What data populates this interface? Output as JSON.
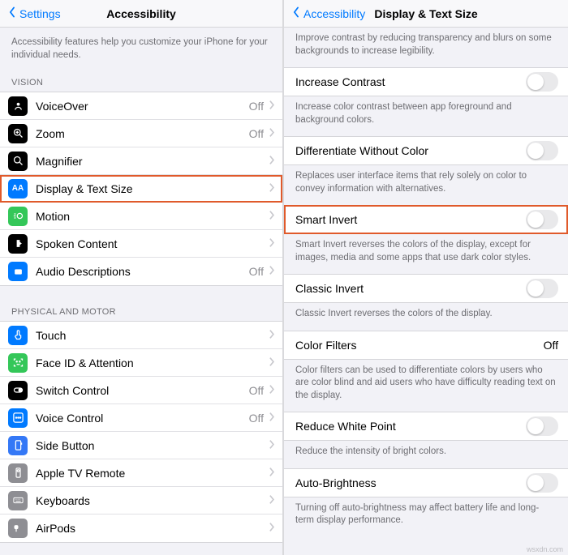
{
  "left": {
    "back": "Settings",
    "title": "Accessibility",
    "intro": "Accessibility features help you customize your iPhone for your individual needs.",
    "vision_header": "VISION",
    "vision": [
      {
        "label": "VoiceOver",
        "value": "Off",
        "icon": "voiceover",
        "bg": "bg-black"
      },
      {
        "label": "Zoom",
        "value": "Off",
        "icon": "zoom",
        "bg": "bg-black"
      },
      {
        "label": "Magnifier",
        "value": "",
        "icon": "magnifier",
        "bg": "bg-black"
      },
      {
        "label": "Display & Text Size",
        "value": "",
        "icon": "display-text",
        "bg": "bg-blue",
        "hl": true
      },
      {
        "label": "Motion",
        "value": "",
        "icon": "motion",
        "bg": "bg-green"
      },
      {
        "label": "Spoken Content",
        "value": "",
        "icon": "spoken",
        "bg": "bg-black"
      },
      {
        "label": "Audio Descriptions",
        "value": "Off",
        "icon": "audio-desc",
        "bg": "bg-blue"
      }
    ],
    "motor_header": "PHYSICAL AND MOTOR",
    "motor": [
      {
        "label": "Touch",
        "value": "",
        "icon": "touch",
        "bg": "bg-blue"
      },
      {
        "label": "Face ID & Attention",
        "value": "",
        "icon": "faceid",
        "bg": "bg-green"
      },
      {
        "label": "Switch Control",
        "value": "Off",
        "icon": "switch",
        "bg": "bg-black"
      },
      {
        "label": "Voice Control",
        "value": "Off",
        "icon": "voice",
        "bg": "bg-blue"
      },
      {
        "label": "Side Button",
        "value": "",
        "icon": "side-btn",
        "bg": "bg-blue2"
      },
      {
        "label": "Apple TV Remote",
        "value": "",
        "icon": "tv-remote",
        "bg": "bg-gray"
      },
      {
        "label": "Keyboards",
        "value": "",
        "icon": "keyboard",
        "bg": "bg-gray"
      },
      {
        "label": "AirPods",
        "value": "",
        "icon": "airpods",
        "bg": "bg-gray"
      }
    ]
  },
  "right": {
    "back": "Accessibility",
    "title": "Display & Text Size",
    "top_desc": "Improve contrast by reducing transparency and blurs on some backgrounds to increase legibility.",
    "items": [
      {
        "type": "toggle",
        "label": "Increase Contrast",
        "desc": "Increase color contrast between app foreground and background colors."
      },
      {
        "type": "toggle",
        "label": "Differentiate Without Color",
        "desc": "Replaces user interface items that rely solely on color to convey information with alternatives."
      },
      {
        "type": "toggle",
        "label": "Smart Invert",
        "desc": "Smart Invert reverses the colors of the display, except for images, media and some apps that use dark color styles.",
        "hl": true
      },
      {
        "type": "toggle",
        "label": "Classic Invert",
        "desc": "Classic Invert reverses the colors of the display."
      },
      {
        "type": "link",
        "label": "Color Filters",
        "value": "Off",
        "desc": "Color filters can be used to differentiate colors by users who are color blind and aid users who have difficulty reading text on the display."
      },
      {
        "type": "toggle",
        "label": "Reduce White Point",
        "desc": "Reduce the intensity of bright colors."
      },
      {
        "type": "toggle",
        "label": "Auto-Brightness",
        "desc": "Turning off auto-brightness may affect battery life and long-term display performance."
      }
    ],
    "watermark": "wsxdn.com"
  }
}
